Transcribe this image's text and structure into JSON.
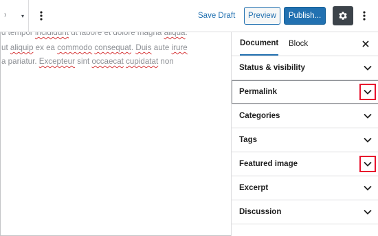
{
  "toolbar": {
    "block_switcher": {
      "glyph": "⁾",
      "caret": "▾"
    },
    "more_tools_icon": "vertical-ellipsis",
    "save_draft_label": "Save Draft",
    "preview_label": "Preview",
    "publish_label": "Publish...",
    "settings_icon": "gear",
    "options_icon": "vertical-ellipsis"
  },
  "editor": {
    "lines": [
      [
        {
          "t": "d tempor "
        },
        {
          "t": "incididunt",
          "spell": true
        },
        {
          "t": " ut labore et dolore magna "
        },
        {
          "t": "aliqua",
          "spell": true
        },
        {
          "t": "."
        }
      ],
      [
        {
          "t": " ut "
        },
        {
          "t": "aliquip",
          "spell": true
        },
        {
          "t": " ex ea "
        },
        {
          "t": "commodo",
          "spell": true
        },
        {
          "t": " "
        },
        {
          "t": "consequat",
          "spell": true
        },
        {
          "t": ". "
        },
        {
          "t": "Duis",
          "spell": true
        },
        {
          "t": " aute "
        },
        {
          "t": "irure",
          "spell": true
        }
      ],
      [
        {
          "t": " a pariatur. "
        },
        {
          "t": "Excepteur",
          "spell": true
        },
        {
          "t": " sint "
        },
        {
          "t": "occaecat",
          "spell": true
        },
        {
          "t": " "
        },
        {
          "t": "cupidatat",
          "spell": true
        },
        {
          "t": " non"
        }
      ]
    ]
  },
  "sidebar": {
    "tabs": [
      {
        "label": "Document",
        "active": true
      },
      {
        "label": "Block",
        "active": false
      }
    ],
    "close_icon": "close",
    "panels": [
      {
        "label": "Status & visibility",
        "highlighted": false,
        "focused": false
      },
      {
        "label": "Permalink",
        "highlighted": true,
        "focused": true
      },
      {
        "label": "Categories",
        "highlighted": false,
        "focused": false
      },
      {
        "label": "Tags",
        "highlighted": false,
        "focused": false
      },
      {
        "label": "Featured image",
        "highlighted": true,
        "focused": false
      },
      {
        "label": "Excerpt",
        "highlighted": false,
        "focused": false
      },
      {
        "label": "Discussion",
        "highlighted": false,
        "focused": false
      }
    ]
  },
  "colors": {
    "accent": "#2271b1",
    "highlight_box": "#e8112d",
    "settings_bg": "#3c434a",
    "placeholder_text": "#8c8f94"
  }
}
